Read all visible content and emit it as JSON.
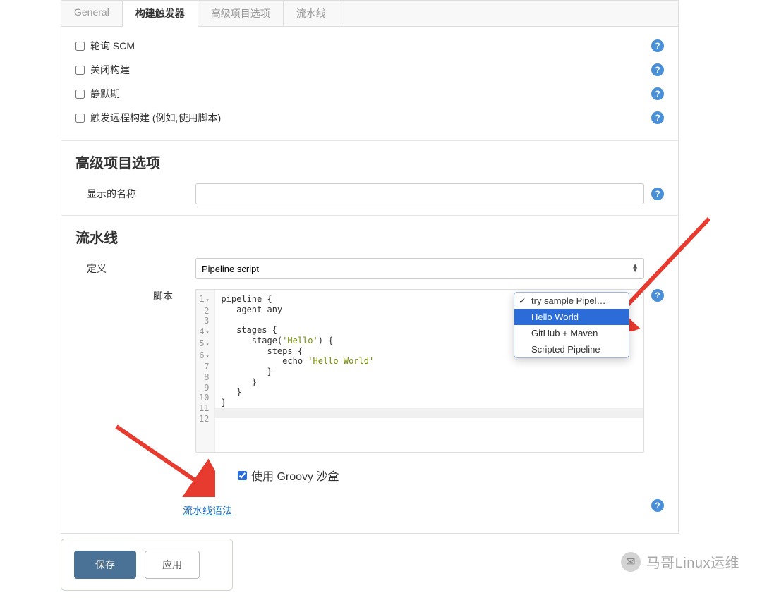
{
  "tabs": {
    "general": "General",
    "build_triggers": "构建触发器",
    "advanced": "高级项目选项",
    "pipeline": "流水线"
  },
  "triggers": {
    "poll_scm": "轮询 SCM",
    "disable_build": "关闭构建",
    "quiet_period": "静默期",
    "remote_trigger": "触发远程构建 (例如,使用脚本)"
  },
  "sections": {
    "advanced_title": "高级项目选项",
    "display_name_label": "显示的名称",
    "pipeline_title": "流水线",
    "definition_label": "定义",
    "definition_value": "Pipeline script",
    "script_label": "脚本",
    "sandbox_label": "使用 Groovy 沙盒",
    "syntax_link": "流水线语法"
  },
  "editor": {
    "lines": [
      "1",
      "2",
      "3",
      "4",
      "5",
      "6",
      "7",
      "8",
      "9",
      "10",
      "11",
      "12"
    ],
    "code": "pipeline {\n   agent any\n\n   stages {\n      stage('Hello') {\n         steps {\n            echo 'Hello World'\n         }\n      }\n   }\n}"
  },
  "sample_dropdown": {
    "item0": "try sample Pipel…",
    "item1": "Hello World",
    "item2": "GitHub + Maven",
    "item3": "Scripted Pipeline"
  },
  "buttons": {
    "save": "保存",
    "apply": "应用"
  },
  "watermark": {
    "text": "马哥Linux运维"
  },
  "help_glyph": "?"
}
